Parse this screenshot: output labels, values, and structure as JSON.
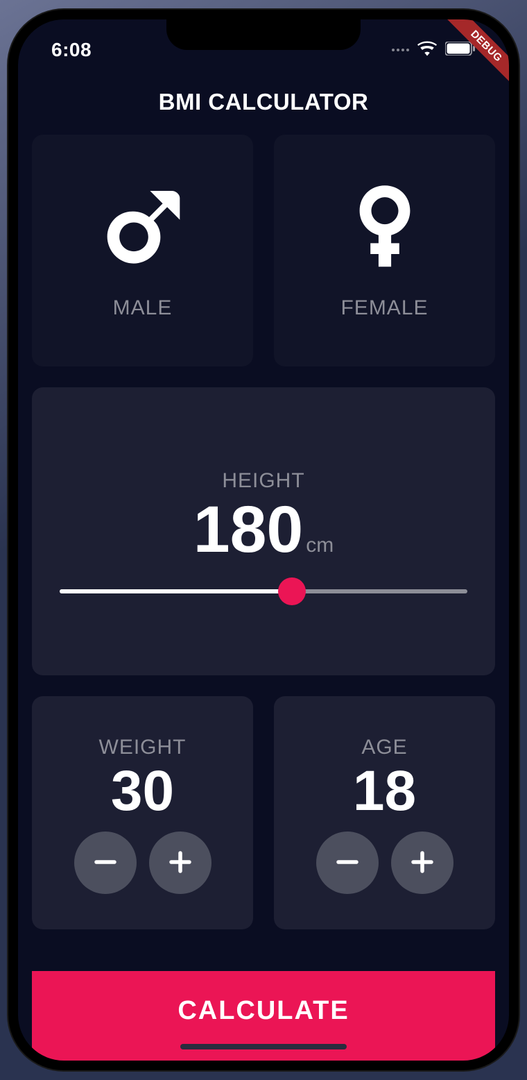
{
  "status": {
    "time": "6:08"
  },
  "debug_banner": "DEBUG",
  "app_title": "BMI CALCULATOR",
  "gender": {
    "male_label": "MALE",
    "female_label": "FEMALE"
  },
  "height": {
    "label": "HEIGHT",
    "value": "180",
    "unit": "cm",
    "min": 120,
    "max": 220,
    "slider_percent": 57
  },
  "weight": {
    "label": "WEIGHT",
    "value": "30"
  },
  "age": {
    "label": "AGE",
    "value": "18"
  },
  "calculate_label": "CALCULATE",
  "colors": {
    "accent": "#eb1555",
    "card": "#1d1f33",
    "card_dark": "#111428",
    "bg": "#0a0d22",
    "muted": "#8d8e98"
  }
}
